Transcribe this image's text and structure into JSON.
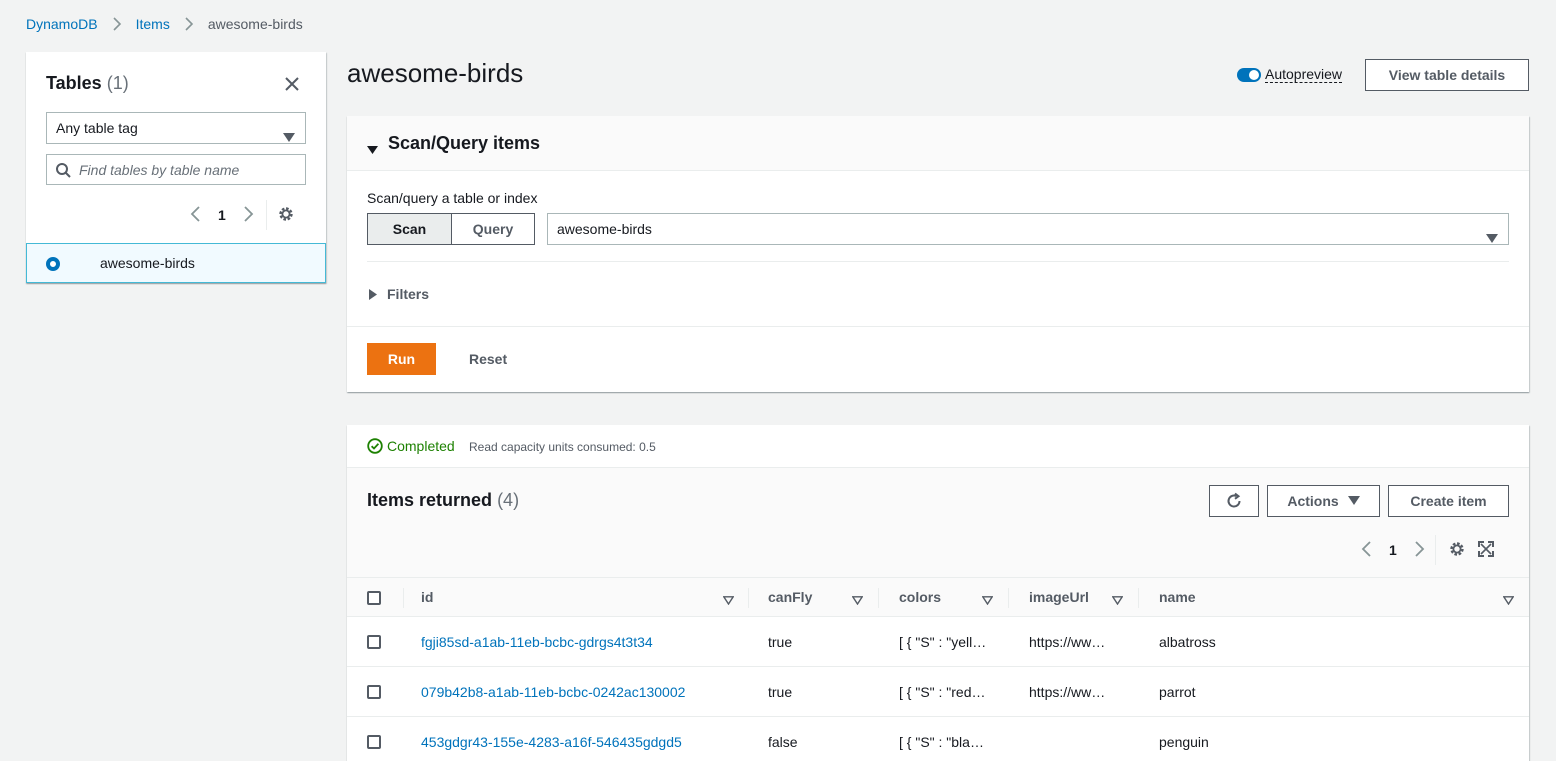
{
  "breadcrumb": {
    "root": "DynamoDB",
    "items": "Items",
    "current": "awesome-birds"
  },
  "sidebar": {
    "title": "Tables",
    "count": "(1)",
    "tag_filter": "Any table tag",
    "search_placeholder": "Find tables by table name",
    "page": "1",
    "tables": [
      {
        "name": "awesome-birds",
        "selected": true
      }
    ]
  },
  "header": {
    "title": "awesome-birds",
    "autopreview_label": "Autopreview",
    "view_details_label": "View table details"
  },
  "scan_panel": {
    "title": "Scan/Query items",
    "mode_label": "Scan/query a table or index",
    "scan_label": "Scan",
    "query_label": "Query",
    "selected_table": "awesome-birds",
    "filters_label": "Filters",
    "run_label": "Run",
    "reset_label": "Reset"
  },
  "results": {
    "status": "Completed",
    "capacity": "Read capacity units consumed: 0.5",
    "title": "Items returned",
    "count": "(4)",
    "actions_label": "Actions",
    "create_label": "Create item",
    "page": "1",
    "columns": [
      "id",
      "canFly",
      "colors",
      "imageUrl",
      "name"
    ],
    "rows": [
      {
        "id": "fgji85sd-a1ab-11eb-bcbc-gdrgs4t3t34",
        "canFly": "true",
        "colors": "[ { \"S\" : \"yell…",
        "imageUrl": "https://ww…",
        "name": "albatross"
      },
      {
        "id": "079b42b8-a1ab-11eb-bcbc-0242ac130002",
        "canFly": "true",
        "colors": "[ { \"S\" : \"red…",
        "imageUrl": "https://ww…",
        "name": "parrot"
      },
      {
        "id": "453gdgr43-155e-4283-a16f-546435gdgd5",
        "canFly": "false",
        "colors": "[ { \"S\" : \"bla…",
        "imageUrl": "",
        "name": "penguin"
      }
    ]
  },
  "colors": {
    "link": "#0073bb",
    "run": "#ec7211",
    "success": "#1d8102",
    "selected_border": "#44b9d6"
  }
}
